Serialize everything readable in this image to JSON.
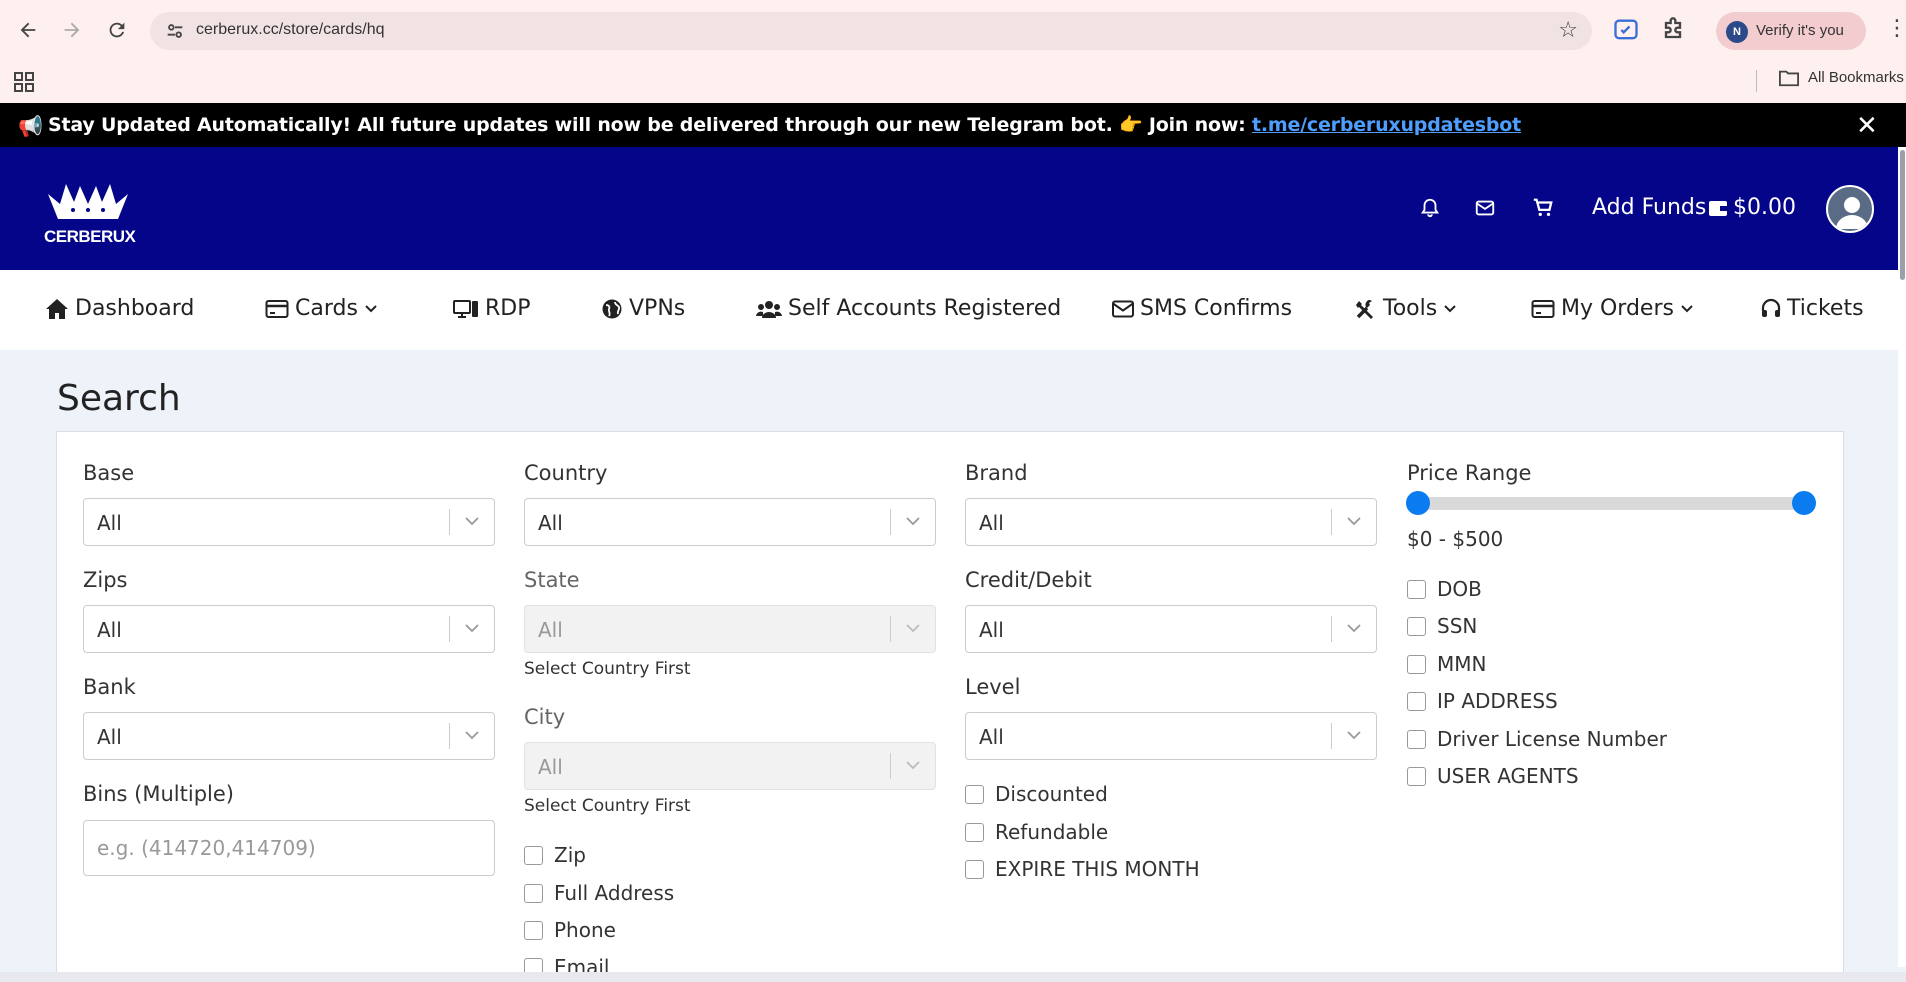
{
  "browser": {
    "url": "cerberux.cc/store/cards/hq",
    "profile_initial": "N",
    "profile_label": "Verify it's you",
    "bookmarks_label": "All Bookmarks"
  },
  "announcement": {
    "icon": "📢",
    "text": "Stay Updated Automatically! All future updates will now be delivered through our new Telegram bot. 👉 Join now: ",
    "link_text": "t.me/cerberuxupdatesbot"
  },
  "header": {
    "logo_text": "CERBERUX",
    "add_funds_label": "Add Funds",
    "balance": "$0.00"
  },
  "nav": {
    "dashboard": "Dashboard",
    "cards": "Cards",
    "rdp": "RDP",
    "vpns": "VPNs",
    "self_accounts": "Self Accounts Registered",
    "sms": "SMS Confirms",
    "tools": "Tools",
    "orders": "My Orders",
    "tickets": "Tickets"
  },
  "search": {
    "title": "Search",
    "base": {
      "label": "Base",
      "value": "All"
    },
    "zips": {
      "label": "Zips",
      "value": "All"
    },
    "bank": {
      "label": "Bank",
      "value": "All"
    },
    "bins": {
      "label": "Bins (Multiple)",
      "placeholder": "e.g. (414720,414709)"
    },
    "country": {
      "label": "Country",
      "value": "All"
    },
    "state": {
      "label": "State",
      "value": "All",
      "hint": "Select Country First"
    },
    "city": {
      "label": "City",
      "value": "All",
      "hint": "Select Country First"
    },
    "col2_checks": [
      "Zip",
      "Full Address",
      "Phone",
      "Email"
    ],
    "brand": {
      "label": "Brand",
      "value": "All"
    },
    "credit_debit": {
      "label": "Credit/Debit",
      "value": "All"
    },
    "level": {
      "label": "Level",
      "value": "All"
    },
    "col3_checks": [
      "Discounted",
      "Refundable",
      "EXPIRE THIS MONTH"
    ],
    "price": {
      "label": "Price Range",
      "value": "$0 - $500",
      "min": 0,
      "max": 500,
      "low_fraction": 0,
      "high_fraction": 1
    },
    "col4_checks": [
      "DOB",
      "SSN",
      "MMN",
      "IP ADDRESS",
      "Driver License Number",
      "USER AGENTS"
    ]
  },
  "colors": {
    "header_bg": "#05058a",
    "accent": "#0b7cf0",
    "announce_bg": "#000000",
    "link": "#4d9eff"
  }
}
